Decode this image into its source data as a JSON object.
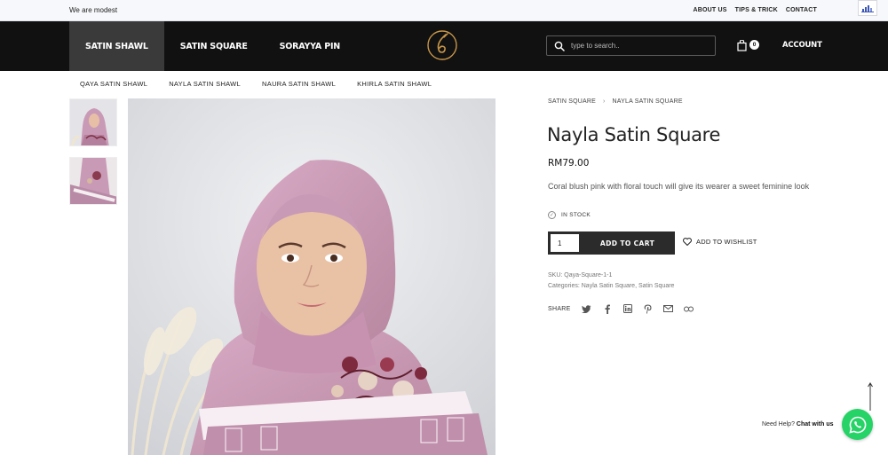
{
  "topbar": {
    "tagline": "We are modest",
    "links": [
      "ABOUT US",
      "TIPS & TRICK",
      "CONTACT"
    ]
  },
  "header": {
    "nav": [
      "SATIN SHAWL",
      "SATIN SQUARE",
      "SORAYYA PIN"
    ],
    "search_placeholder": "type to search..",
    "cart_count": "0",
    "account": "ACCOUNT"
  },
  "subnav": [
    "QAYA SATIN SHAWL",
    "NAYLA SATIN SHAWL",
    "NAURA SATIN SHAWL",
    "KHIRLA SATIN SHAWL"
  ],
  "breadcrumb": {
    "parent": "SATIN SQUARE",
    "separator": "›",
    "current": "NAYLA SATIN SQUARE"
  },
  "product": {
    "title": "Nayla Satin Square",
    "price": "RM79.00",
    "description": "Coral blush pink with floral touch will give its wearer a sweet feminine look",
    "stock": "IN STOCK",
    "qty": "1",
    "add_to_cart": "ADD TO CART",
    "wishlist": "ADD TO WISHLIST",
    "sku_label": "SKU:",
    "sku": "Qaya-Square-1-1",
    "categories_label": "Categories:",
    "categories": [
      "Nayla Satin Square",
      "Satin Square"
    ],
    "share_label": "SHARE"
  },
  "chat": {
    "need_help": "Need Help?",
    "chat_with_us": "Chat with us"
  },
  "colors": {
    "header_bg": "#111111",
    "nav_active": "#3a3a3a",
    "logo_gold": "#c9974a",
    "hijab": "#c99ab6",
    "whatsapp": "#25d366"
  },
  "icons": [
    "search-icon",
    "cart-icon",
    "check-icon",
    "heart-icon",
    "twitter-icon",
    "facebook-icon",
    "linkedin-icon",
    "pinterest-icon",
    "mail-icon",
    "link-icon",
    "arrow-up-icon",
    "whatsapp-icon"
  ]
}
